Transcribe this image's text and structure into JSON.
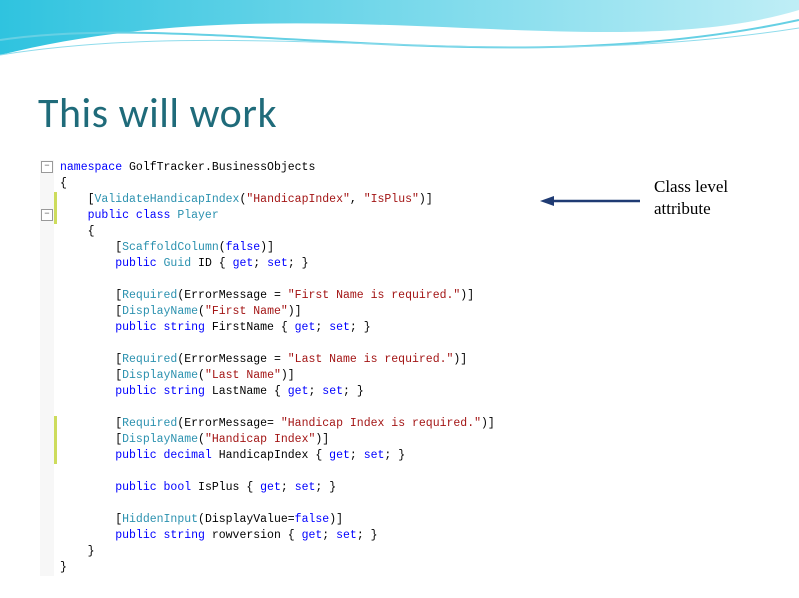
{
  "slide": {
    "title": "This will work",
    "annotation_line1": "Class level",
    "annotation_line2": "attribute"
  },
  "code": {
    "line01_a": "namespace",
    "line01_b": " GolfTracker.BusinessObjects",
    "line02": "{",
    "line03_a": "    [",
    "line03_b": "ValidateHandicapIndex",
    "line03_c": "(",
    "line03_d": "\"HandicapIndex\"",
    "line03_e": ", ",
    "line03_f": "\"IsPlus\"",
    "line03_g": ")]",
    "line04_a": "    ",
    "line04_b": "public class ",
    "line04_c": "Player",
    "line05": "    {",
    "line06_a": "        [",
    "line06_b": "ScaffoldColumn",
    "line06_c": "(",
    "line06_d": "false",
    "line06_e": ")]",
    "line07_a": "        ",
    "line07_b": "public ",
    "line07_c": "Guid",
    "line07_d": " ID { ",
    "line07_e": "get",
    "line07_f": "; ",
    "line07_g": "set",
    "line07_h": "; }",
    "line09_a": "        [",
    "line09_b": "Required",
    "line09_c": "(ErrorMessage = ",
    "line09_d": "\"First Name is required.\"",
    "line09_e": ")]",
    "line10_a": "        [",
    "line10_b": "DisplayName",
    "line10_c": "(",
    "line10_d": "\"First Name\"",
    "line10_e": ")]",
    "line11_a": "        ",
    "line11_b": "public string",
    "line11_c": " FirstName { ",
    "line11_d": "get",
    "line11_e": "; ",
    "line11_f": "set",
    "line11_g": "; }",
    "line13_a": "        [",
    "line13_b": "Required",
    "line13_c": "(ErrorMessage = ",
    "line13_d": "\"Last Name is required.\"",
    "line13_e": ")]",
    "line14_a": "        [",
    "line14_b": "DisplayName",
    "line14_c": "(",
    "line14_d": "\"Last Name\"",
    "line14_e": ")]",
    "line15_a": "        ",
    "line15_b": "public string",
    "line15_c": " LastName { ",
    "line15_d": "get",
    "line15_e": "; ",
    "line15_f": "set",
    "line15_g": "; }",
    "line17_a": "        [",
    "line17_b": "Required",
    "line17_c": "(ErrorMessage= ",
    "line17_d": "\"Handicap Index is required.\"",
    "line17_e": ")]",
    "line18_a": "        [",
    "line18_b": "DisplayName",
    "line18_c": "(",
    "line18_d": "\"Handicap Index\"",
    "line18_e": ")]",
    "line19_a": "        ",
    "line19_b": "public decimal",
    "line19_c": " HandicapIndex { ",
    "line19_d": "get",
    "line19_e": "; ",
    "line19_f": "set",
    "line19_g": "; }",
    "line21_a": "        ",
    "line21_b": "public bool",
    "line21_c": " IsPlus { ",
    "line21_d": "get",
    "line21_e": "; ",
    "line21_f": "set",
    "line21_g": "; }",
    "line23_a": "        [",
    "line23_b": "HiddenInput",
    "line23_c": "(DisplayValue=",
    "line23_d": "false",
    "line23_e": ")]",
    "line24_a": "        ",
    "line24_b": "public string",
    "line24_c": " rowversion { ",
    "line24_d": "get",
    "line24_e": "; ",
    "line24_f": "set",
    "line24_g": "; }",
    "line25": "    }",
    "line26": "}"
  }
}
